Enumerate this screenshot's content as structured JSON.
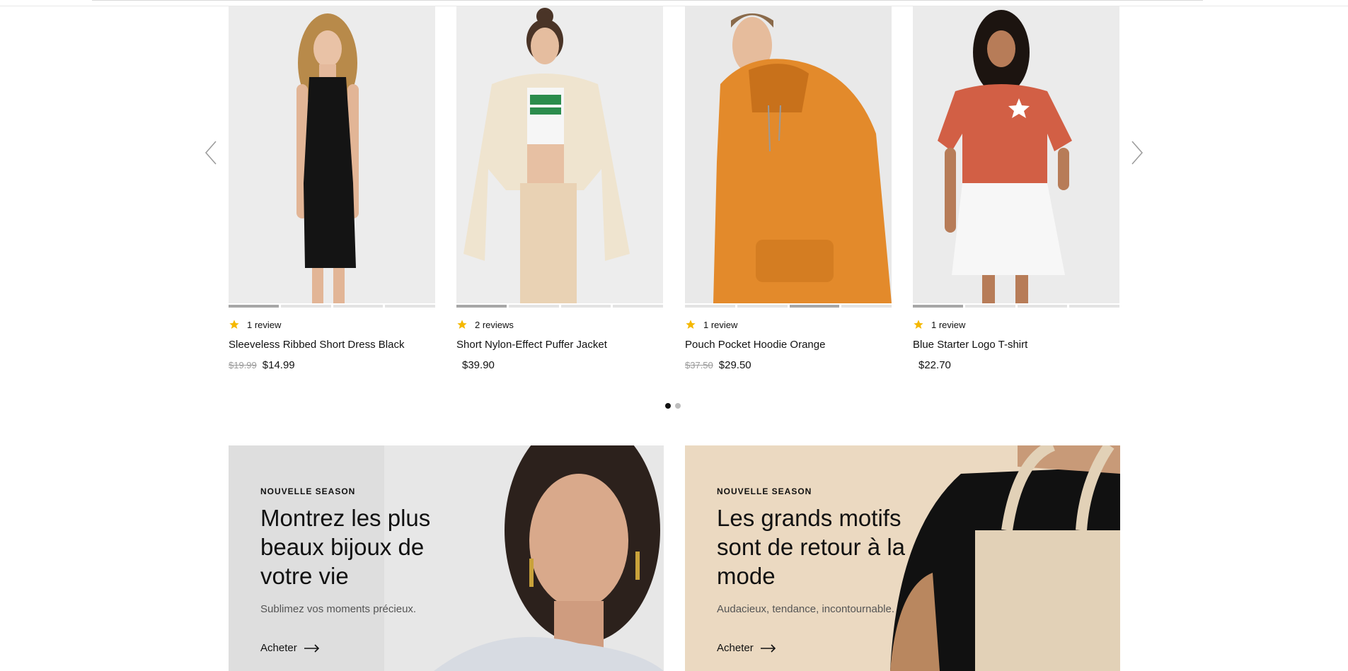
{
  "carousel": {
    "prev_label": "Previous",
    "next_label": "Next",
    "icons": {
      "prev": "chevron-left-icon",
      "next": "chevron-right-icon",
      "star": "star-icon"
    },
    "colors": {
      "star": "#f5b800",
      "active_dot": "#111111",
      "inactive_dot": "#bdbdbd"
    },
    "products": [
      {
        "reviews": "1 review",
        "name": "Sleeveless Ribbed Short Dress Black",
        "old_price": "$19.99",
        "price": "$14.99",
        "active_slide": 1
      },
      {
        "reviews": "2 reviews",
        "name": "Short Nylon-Effect Puffer Jacket",
        "old_price": "",
        "price": "$39.90",
        "active_slide": 1
      },
      {
        "reviews": "1 review",
        "name": "Pouch Pocket Hoodie Orange",
        "old_price": "$37.50",
        "price": "$29.50",
        "active_slide": 3
      },
      {
        "reviews": "1 review",
        "name": "Blue Starter Logo T-shirt",
        "old_price": "",
        "price": "$22.70",
        "active_slide": 1
      }
    ],
    "pagination": {
      "pages": 2,
      "current": 1
    }
  },
  "banners": [
    {
      "eyebrow": "NOUVELLE SEASON",
      "title": "Montrez les plus beaux bijoux de votre vie",
      "subtitle": "Sublimez vos moments précieux.",
      "cta": "Acheter",
      "background": "#dfdfdf"
    },
    {
      "eyebrow": "NOUVELLE SEASON",
      "title": "Les grands motifs sont de retour à la mode",
      "subtitle": "Audacieux, tendance, incontournable.",
      "cta": "Acheter",
      "background": "#ead8bf"
    }
  ]
}
